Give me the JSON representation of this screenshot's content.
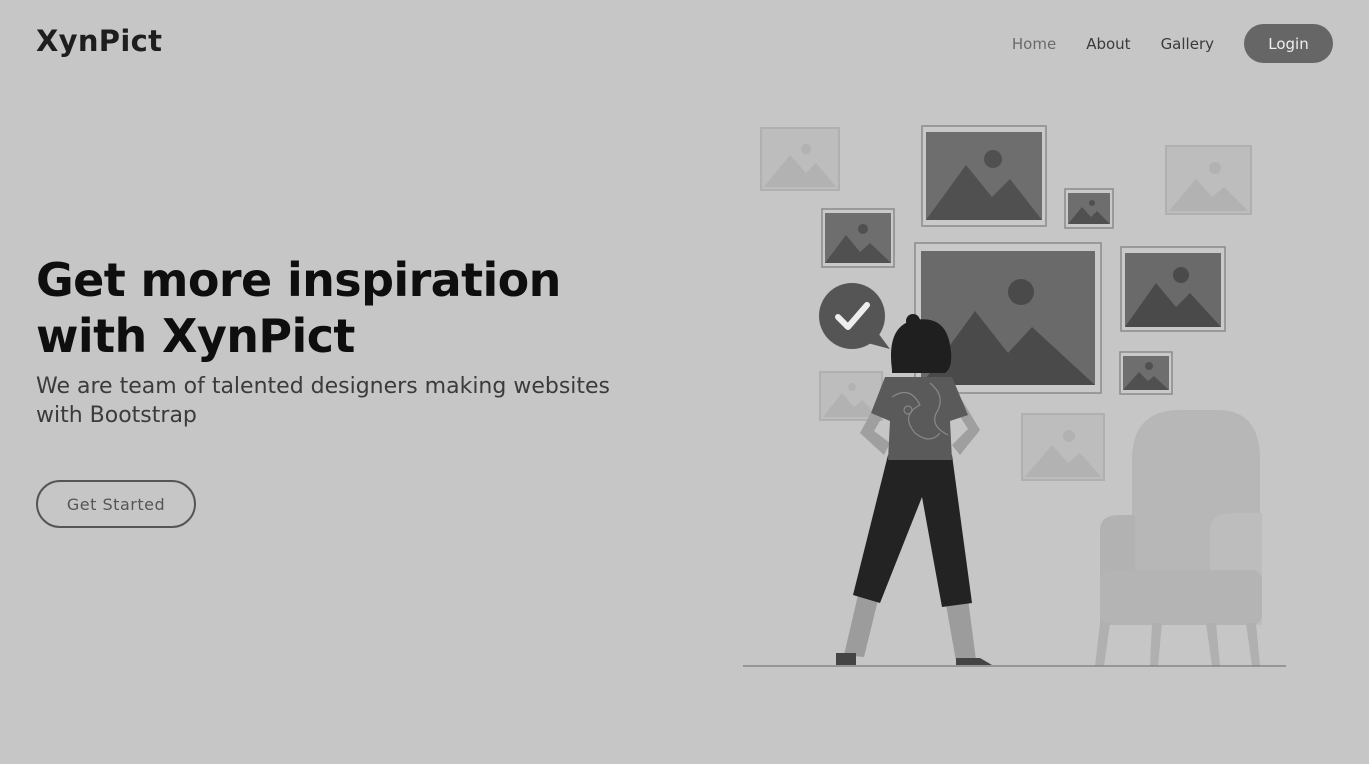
{
  "header": {
    "brand": "XynPict",
    "nav": [
      {
        "label": "Home"
      },
      {
        "label": "About"
      },
      {
        "label": "Gallery"
      }
    ],
    "login_label": "Login"
  },
  "hero": {
    "title": "Get more inspiration with XynPict",
    "subtitle": "We are team of talented designers making websites with Bootstrap",
    "cta_label": "Get Started"
  },
  "illustration": {
    "description_icon": "person-viewing-gallery-illustration",
    "colors": {
      "background": "#c6c6c6",
      "frame_dark": "#6b6b6b",
      "frame_light": "#b8b8b8",
      "figure": "#222222",
      "chair": "#b5b5b5",
      "button": "#666666"
    }
  }
}
